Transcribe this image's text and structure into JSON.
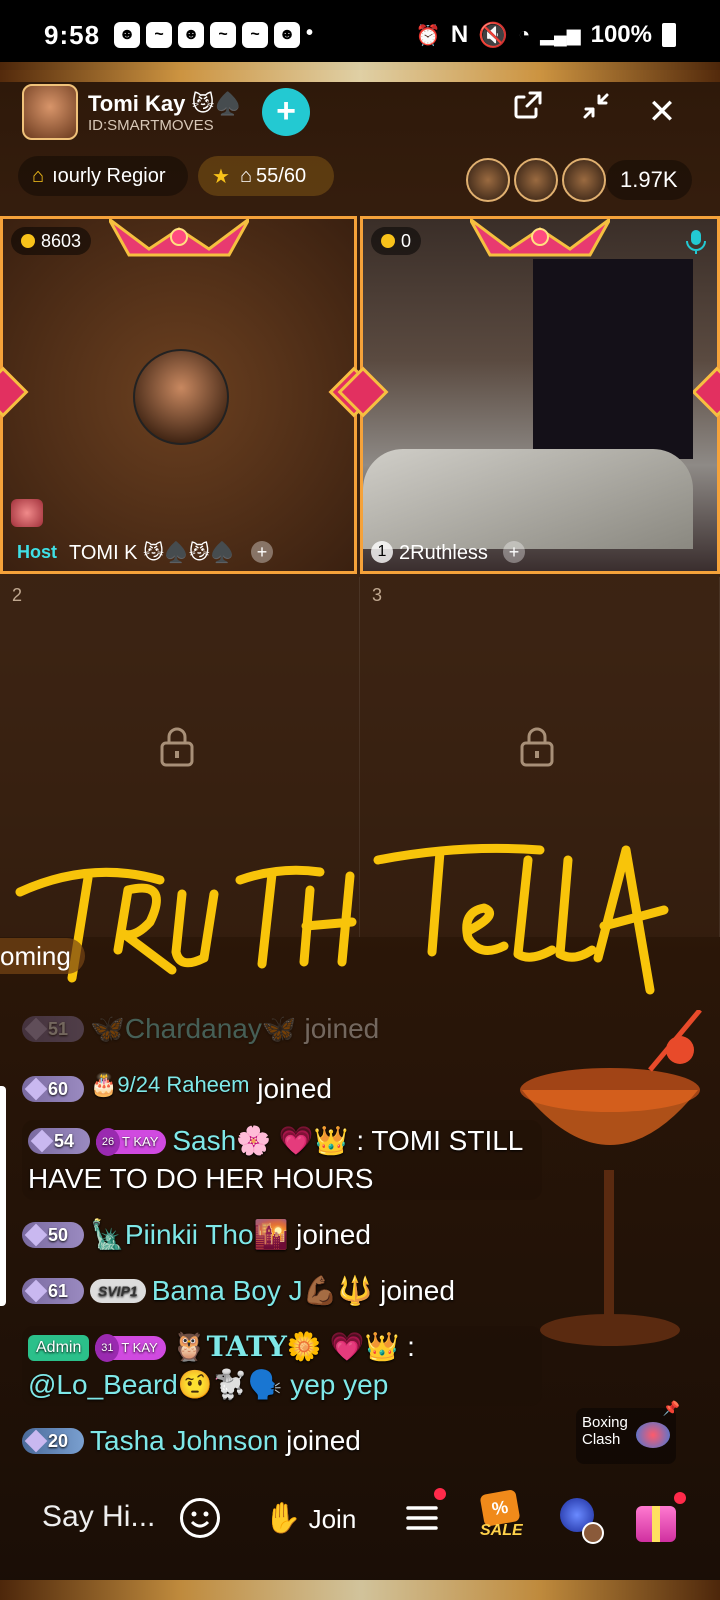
{
  "status_bar": {
    "time": "9:58",
    "battery": "100%"
  },
  "host": {
    "name": "Tomi Kay 😼♠️",
    "id": "ID:SMARTMOVES"
  },
  "header": {
    "hourly_region": "Hourly Regior",
    "hourly_region_visible": "ıourly Regior",
    "seat_count": "55/60",
    "viewer_count": "1.97K"
  },
  "seats": [
    {
      "index": "",
      "coins": "8603",
      "tag": "Host",
      "name": "TOMI K 😼♠️😼♠️"
    },
    {
      "index": "1",
      "coins": "0",
      "name": "2Ruthless"
    },
    {
      "number": "2"
    },
    {
      "number": "3"
    }
  ],
  "signature_text": "TRUTH TELLA",
  "incoming_label": "oming",
  "chat": [
    {
      "level": "51",
      "name": "🦋Chardanay🦋",
      "text": "joined"
    },
    {
      "level": "60",
      "name": "🎂9/24 Raheem",
      "text": "joined"
    },
    {
      "level": "54",
      "fan_level": "26",
      "fan_label": "T KAY",
      "name": "Sash🌸",
      "badges": "💗👑",
      "text": ": TOMI STILL HAVE TO DO HER HOURS"
    },
    {
      "level": "50",
      "name": "🗽Piinkii Tho🌇",
      "text": "joined"
    },
    {
      "level": "61",
      "svip": "SVIP1",
      "name": "Bama Boy J💪🏾🔱",
      "text": "joined"
    },
    {
      "admin": "Admin",
      "fan_level": "31",
      "fan_label": "T KAY",
      "name": "🦉TATY🌼",
      "badges": "💗👑",
      "text": ":",
      "text2": "@Lo_Beard🤨🐩🗣️ yep yep"
    },
    {
      "level": "20",
      "name": "Tasha Johnson",
      "text": "joined"
    }
  ],
  "boxing_label": "Boxing Clash",
  "bottom": {
    "input_placeholder": "Say Hi...",
    "join_label": "Join",
    "sale_label": "SALE"
  },
  "colors": {
    "accent_teal": "#23c9d2",
    "seat_border": "#f5a23a",
    "admin_green": "#2bc08a",
    "name_cyan": "#7fe8e8"
  }
}
